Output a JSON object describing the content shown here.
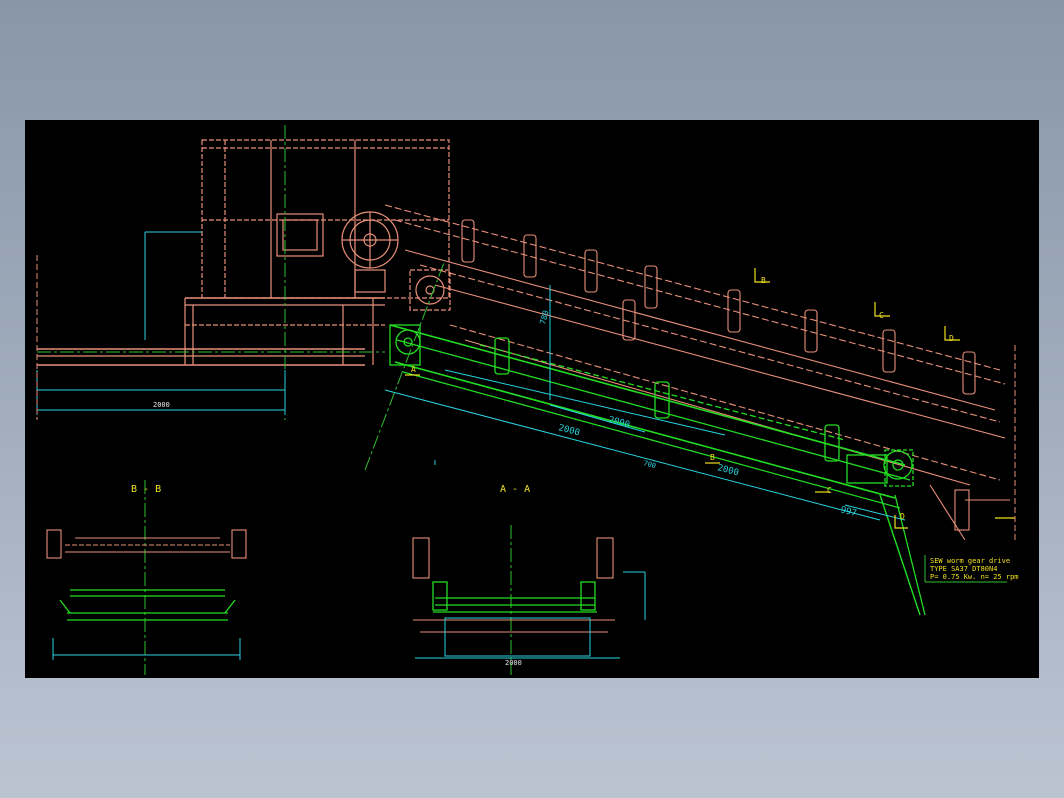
{
  "colors": {
    "background": "#000000",
    "frame_bg": "#97a3b5",
    "structure": "#e8907a",
    "conveyor": "#22dd22",
    "dimension": "#28d4e0",
    "centerline": "#2fbf2f",
    "markers": "#f0e020",
    "text_white": "#e8e8e8"
  },
  "sections": {
    "bb_title": "B - B",
    "aa_title": "A - A"
  },
  "markers": {
    "a": "A",
    "b": "B",
    "c": "C",
    "d": "D"
  },
  "dimensions": {
    "total_length_left": "2000",
    "belt_2000_a": "2000",
    "belt_2000_b": "2000",
    "belt_2000_c": "2000",
    "belt_997": "997",
    "belt_700": "700",
    "vertical_780": "780",
    "aa_width": "2000"
  },
  "note": {
    "line1": "SEW worm gear drive",
    "line2": "TYPE SA37 DT80N4",
    "line3": "P= 0.75  Kw.  n= 25  rpm"
  }
}
